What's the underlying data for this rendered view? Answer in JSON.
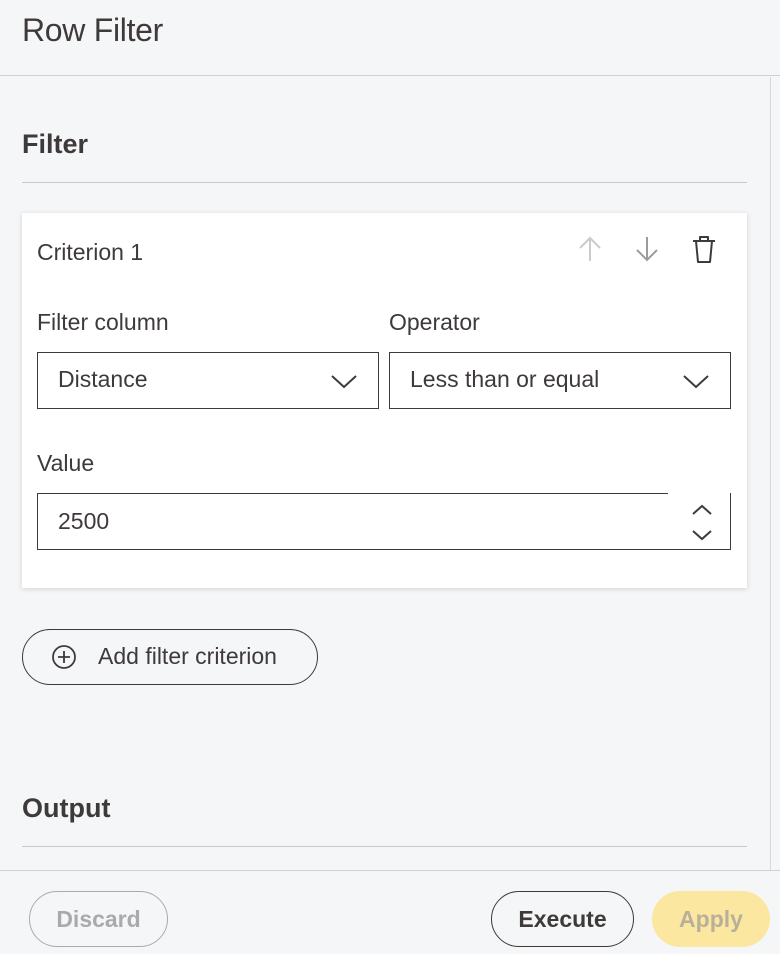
{
  "header": {
    "title": "Row Filter"
  },
  "sections": {
    "filter_title": "Filter",
    "output_title": "Output"
  },
  "criterion": {
    "title": "Criterion 1",
    "icons": {
      "move_up": "arrow-up-icon",
      "move_down": "arrow-down-icon",
      "delete": "trash-icon"
    },
    "filter_column": {
      "label": "Filter column",
      "value": "Distance"
    },
    "operator": {
      "label": "Operator",
      "value": "Less than or equal"
    },
    "value_field": {
      "label": "Value",
      "value": "2500"
    }
  },
  "add_criterion": {
    "label": "Add filter criterion",
    "icon": "plus-circle-icon"
  },
  "footer": {
    "discard_label": "Discard",
    "execute_label": "Execute",
    "apply_label": "Apply"
  },
  "colors": {
    "text": "#3e3a39",
    "background": "#f5f6f7",
    "card": "#ffffff",
    "disabled": "#a8abae",
    "apply_bg": "#fbe7a0"
  }
}
